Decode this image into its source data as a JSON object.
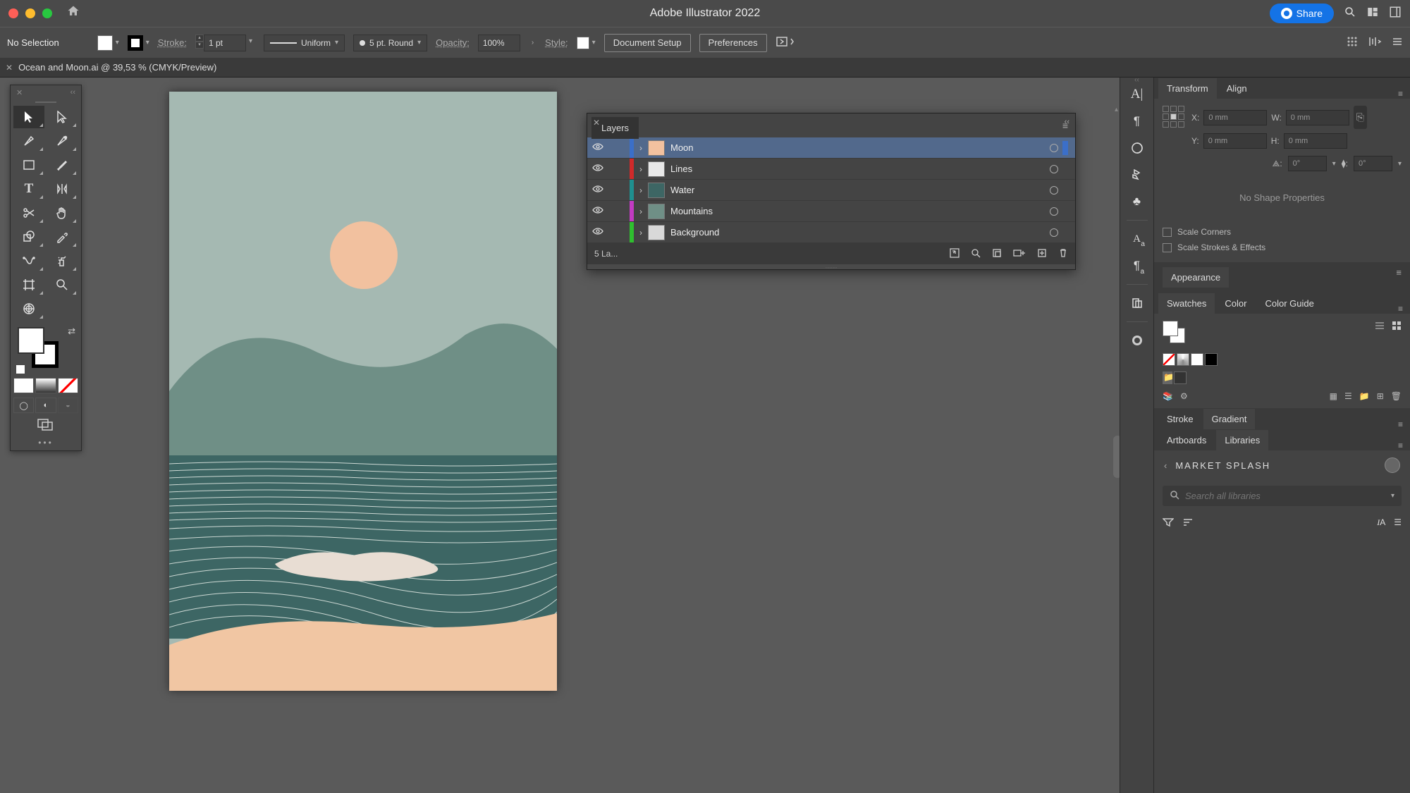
{
  "titlebar": {
    "app_title": "Adobe Illustrator 2022",
    "share_label": "Share"
  },
  "controlbar": {
    "selection_status": "No Selection",
    "stroke_label": "Stroke:",
    "stroke_value": "1 pt",
    "profile_label": "Uniform",
    "cap_label": "5 pt. Round",
    "opacity_label": "Opacity:",
    "opacity_value": "100%",
    "style_label": "Style:",
    "doc_setup": "Document Setup",
    "preferences": "Preferences"
  },
  "document_tab": "Ocean and Moon.ai @ 39,53 % (CMYK/Preview)",
  "layers_panel": {
    "title": "Layers",
    "rows": [
      {
        "name": "Moon",
        "color": "#3b6fc9",
        "thumb": "#f2c19f",
        "selected": true
      },
      {
        "name": "Lines",
        "color": "#d02a2a",
        "thumb": "#e8e8e8",
        "selected": false
      },
      {
        "name": "Water",
        "color": "#1f8f8f",
        "thumb": "#3d6664",
        "selected": false
      },
      {
        "name": "Mountains",
        "color": "#c23bc2",
        "thumb": "#6f8f86",
        "selected": false
      },
      {
        "name": "Background",
        "color": "#2fbf2f",
        "thumb": "#d9d9d9",
        "selected": false
      }
    ],
    "footer_count": "5 La..."
  },
  "transform_panel": {
    "tabs": {
      "transform": "Transform",
      "align": "Align"
    },
    "x_label": "X:",
    "x_value": "0 mm",
    "y_label": "Y:",
    "y_value": "0 mm",
    "w_label": "W:",
    "w_value": "0 mm",
    "h_label": "H:",
    "h_value": "0 mm",
    "angle_label": "⟁:",
    "angle_value": "0°",
    "shear_label": "⧫:",
    "shear_value": "0°",
    "no_shape": "No Shape Properties",
    "scale_corners": "Scale Corners",
    "scale_strokes": "Scale Strokes & Effects"
  },
  "appearance": "Appearance",
  "swatches": {
    "tabs": {
      "swatches": "Swatches",
      "color": "Color",
      "guide": "Color Guide"
    }
  },
  "stroke_gradient": {
    "stroke": "Stroke",
    "gradient": "Gradient"
  },
  "artboards_libs": {
    "artboards": "Artboards",
    "libraries": "Libraries"
  },
  "library": {
    "name": "MARKET SPLASH",
    "search_placeholder": "Search all libraries"
  }
}
